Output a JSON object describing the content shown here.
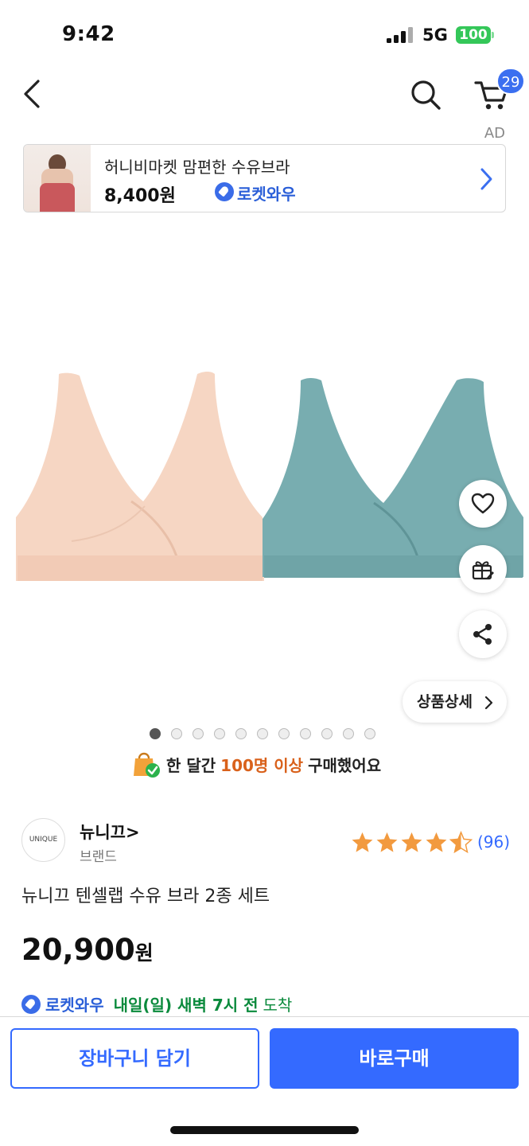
{
  "status_bar": {
    "time": "9:42",
    "network": "5G",
    "battery": "100"
  },
  "header": {
    "cart_count": "29"
  },
  "ad": {
    "label": "AD",
    "title": "허니비마켓 맘편한 수유브라",
    "price": "8,400원",
    "badge": "로켓와우"
  },
  "gallery": {
    "detail_button": "상품상세",
    "page_count": 11,
    "active_page": 1
  },
  "popularity": {
    "prefix": "한 달간",
    "highlight": "100명 이상",
    "suffix": "구매했어요"
  },
  "brand": {
    "logo_text": "UNIQUE",
    "name": "뉴니끄>",
    "sub": "브랜드"
  },
  "rating": {
    "stars": 4.5,
    "count": "(96)"
  },
  "product": {
    "title": "뉴니끄 텐셀랩 수유 브라 2종 세트",
    "price": "20,900",
    "currency": "원"
  },
  "delivery": {
    "badge": "로켓와우",
    "eta": "내일(일) 새벽 7시 전",
    "arrive": "도착"
  },
  "actions": {
    "add_to_cart": "장바구니 담기",
    "buy_now": "바로구매"
  },
  "colors": {
    "accent": "#346aff",
    "rocket": "#2b5fd8",
    "eta_green": "#0a8a3c",
    "star": "#f29a3f",
    "popular_orange": "#d9611b",
    "bra_peach": "#f6d6c3",
    "bra_teal": "#78adb0"
  }
}
